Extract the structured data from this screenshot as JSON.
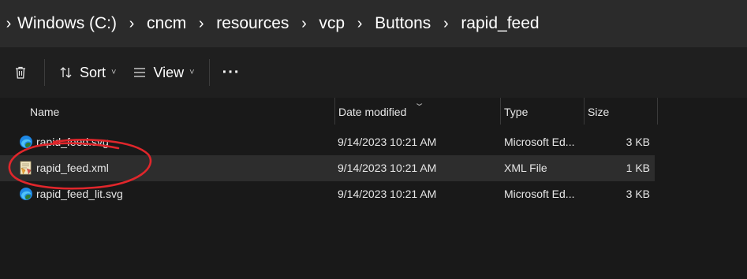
{
  "breadcrumb": {
    "items": [
      "Windows (C:)",
      "cncm",
      "resources",
      "vcp",
      "Buttons",
      "rapid_feed"
    ]
  },
  "toolbar": {
    "delete_icon": "trash-icon",
    "sort_label": "Sort",
    "view_label": "View",
    "more_label": "···"
  },
  "columns": {
    "name": "Name",
    "date": "Date modified",
    "type": "Type",
    "size": "Size"
  },
  "files": [
    {
      "name": "rapid_feed.svg",
      "date": "9/14/2023 10:21 AM",
      "type": "Microsoft Ed...",
      "size": "3 KB",
      "icon": "edge-icon"
    },
    {
      "name": "rapid_feed.xml",
      "date": "9/14/2023 10:21 AM",
      "type": "XML File",
      "size": "1 KB",
      "icon": "xml-file-icon"
    },
    {
      "name": "rapid_feed_lit.svg",
      "date": "9/14/2023 10:21 AM",
      "type": "Microsoft Ed...",
      "size": "3 KB",
      "icon": "edge-icon"
    }
  ],
  "colors": {
    "background": "#191919",
    "addressbar": "#2b2b2b",
    "selected_row": "#2d2d2d",
    "annotation": "#e0262b"
  }
}
